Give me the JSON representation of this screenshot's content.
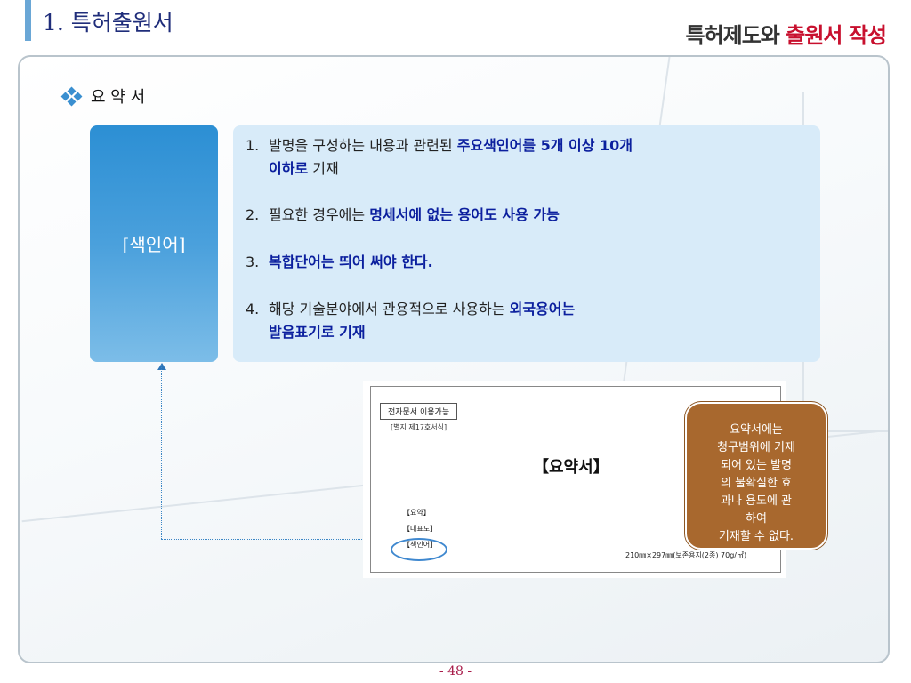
{
  "header": {
    "title": "1. 특허출원서",
    "right_part1": "특허제도와",
    "right_part2": "출원서 작성"
  },
  "section": {
    "title": "요 약 서"
  },
  "label": {
    "text": "[색인어]"
  },
  "items": [
    {
      "num": "1.",
      "pre": "발명을 구성하는 내용과 관련된 ",
      "hl": "주요색인어를 5개 이상 10개",
      "line2_hl": "이하로",
      "line2_post": " 기재"
    },
    {
      "num": "2.",
      "pre": "필요한 경우에는 ",
      "hl": "명세서에 없는 용어도 사용 가능"
    },
    {
      "num": "3.",
      "hl": "복합단어는 띄어 써야 한다."
    },
    {
      "num": "4.",
      "pre": "해당 기술분야에서 관용적으로 사용하는 ",
      "hl": "외국용어는",
      "line2_hl": "발음표기로 기재"
    }
  ],
  "doc": {
    "tag": "전자문서 이용가능",
    "sub": "[별지 제17호서식]",
    "title": "【요약서】",
    "fields": [
      "【요약】",
      "【대표도】",
      "【색인어】"
    ],
    "size": "210㎜×297㎜(보존용지(2종) 70g/㎡)"
  },
  "callout": {
    "text": "요약서에는\n청구범위에 기재\n되어 있는 발명\n의 불확실한 효\n과나 용도에 관\n하여\n기재할 수 없다."
  },
  "page": {
    "number": "- 48 -"
  },
  "colors": {
    "accent": "#2c8fd4",
    "highlight": "#0b1f9e",
    "callout": "#a8682e",
    "red": "#c8102e"
  }
}
